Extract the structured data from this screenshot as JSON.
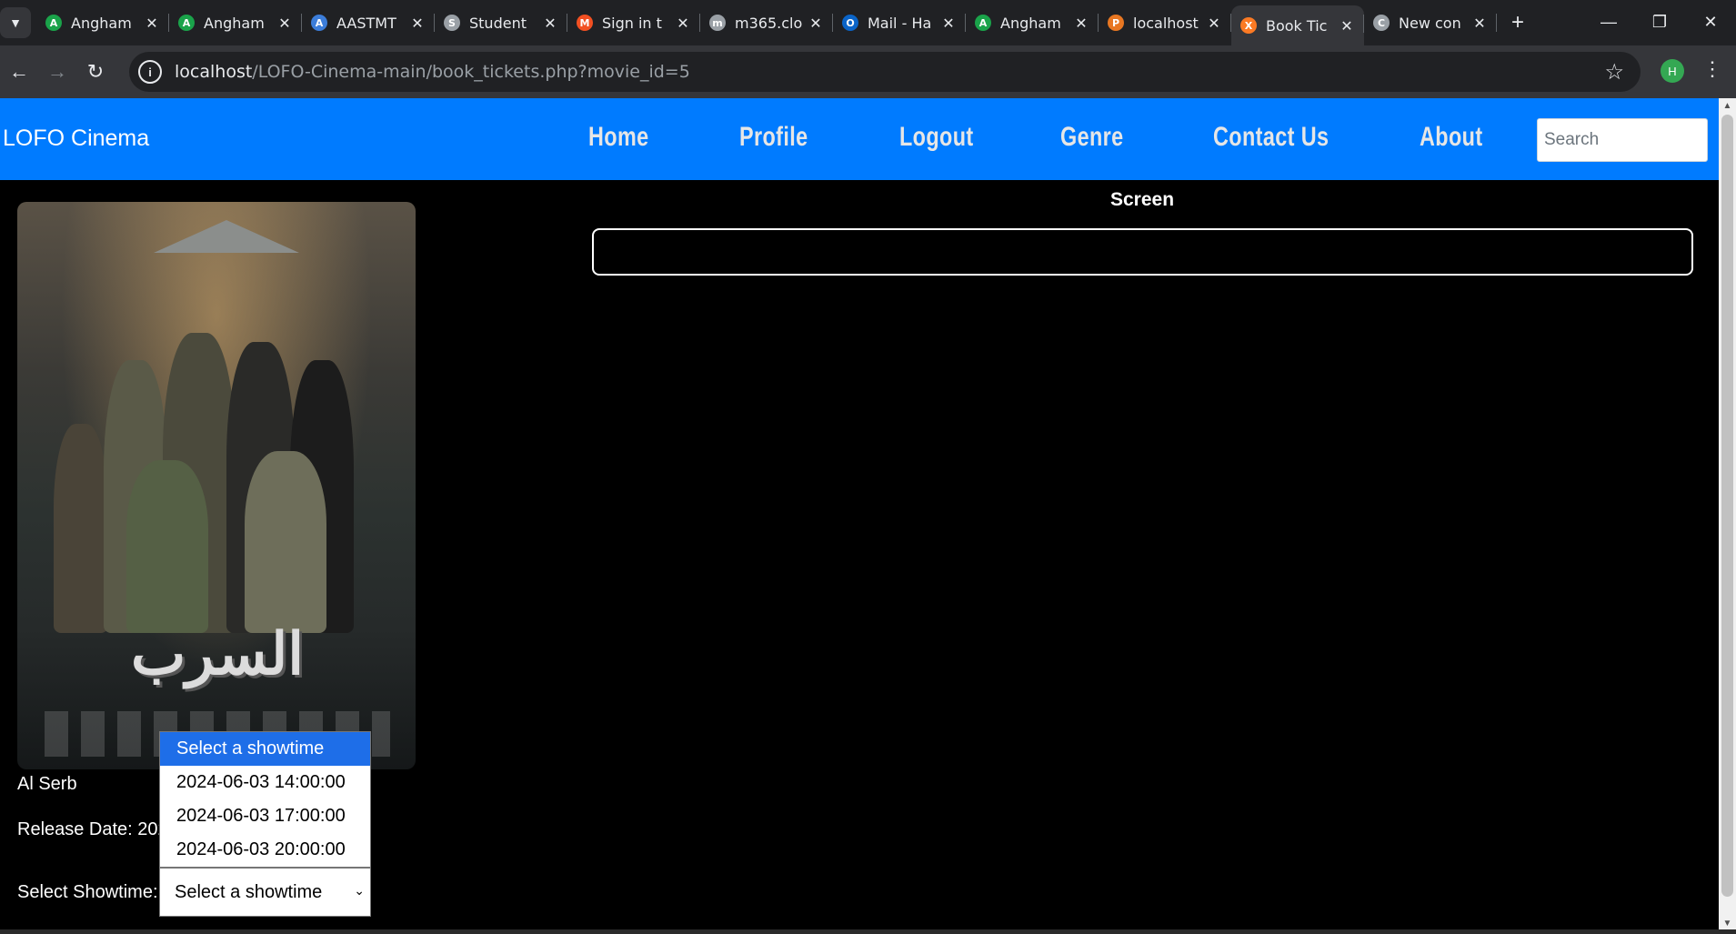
{
  "browser": {
    "tabs": [
      {
        "title": "Angham",
        "favicon_color": "#1aa34a",
        "favicon_glyph": "A"
      },
      {
        "title": "Angham",
        "favicon_color": "#1aa34a",
        "favicon_glyph": "A"
      },
      {
        "title": "AASTMT",
        "favicon_color": "#3c7dd9",
        "favicon_glyph": "A"
      },
      {
        "title": "Student",
        "favicon_color": "#9aa0a6",
        "favicon_glyph": "S"
      },
      {
        "title": "Sign in t",
        "favicon_color": "#f25022",
        "favicon_glyph": "M"
      },
      {
        "title": "m365.clo",
        "favicon_color": "#9aa0a6",
        "favicon_glyph": "m"
      },
      {
        "title": "Mail - Ha",
        "favicon_color": "#0a64c8",
        "favicon_glyph": "O"
      },
      {
        "title": "Angham",
        "favicon_color": "#1aa34a",
        "favicon_glyph": "A"
      },
      {
        "title": "localhost",
        "favicon_color": "#e87722",
        "favicon_glyph": "P"
      },
      {
        "title": "Book Tic",
        "favicon_color": "#fb7a24",
        "favicon_glyph": "X",
        "active": true
      },
      {
        "title": "New con",
        "favicon_color": "#9aa0a6",
        "favicon_glyph": "C"
      }
    ],
    "url_host": "localhost",
    "url_path": "/LOFO-Cinema-main/book_tickets.php?movie_id=5",
    "profile_initial": "H"
  },
  "site": {
    "brand": "LOFO Cinema",
    "nav": [
      "Home",
      "Profile",
      "Logout",
      "Genre",
      "Contact Us",
      "About"
    ],
    "search_placeholder": "Search",
    "accent": "#007bff"
  },
  "screen": {
    "label": "Screen"
  },
  "movie": {
    "title": "Al Serb",
    "poster_title_ar": "السرب",
    "release_label": "Release Date: 2024",
    "showtime_label": "Select Showtime:",
    "selected_showtime": "Select a showtime",
    "showtimes": [
      "Select a showtime",
      "2024-06-03 14:00:00",
      "2024-06-03 17:00:00",
      "2024-06-03 20:00:00"
    ]
  }
}
